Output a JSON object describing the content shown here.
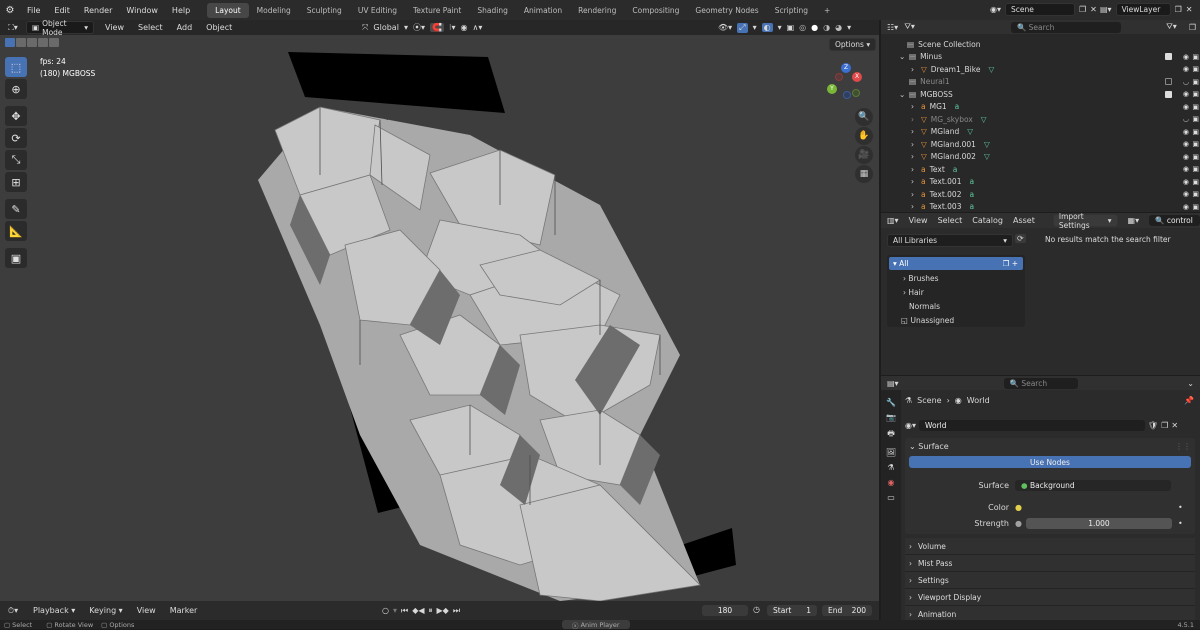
{
  "topbar": {
    "menus": [
      "File",
      "Edit",
      "Render",
      "Window",
      "Help"
    ],
    "workspaces": [
      "Layout",
      "Modeling",
      "Sculpting",
      "UV Editing",
      "Texture Paint",
      "Shading",
      "Animation",
      "Rendering",
      "Compositing",
      "Geometry Nodes",
      "Scripting"
    ],
    "active_workspace": "Layout",
    "add_tab": "+",
    "scene": "Scene",
    "view_layer": "ViewLayer"
  },
  "viewport_header": {
    "mode": "Object Mode",
    "menus": [
      "View",
      "Select",
      "Add",
      "Object"
    ],
    "transform": "Global",
    "options": "Options"
  },
  "viewport": {
    "fps": "fps: 24",
    "frame_label": "(180) MGBOSS",
    "axis": {
      "x": "X",
      "y": "Y",
      "z": "Z"
    }
  },
  "outliner": {
    "search_placeholder": "Search",
    "root": "Scene Collection",
    "rows": [
      {
        "name": "Minus",
        "type": "collection",
        "indent": 1
      },
      {
        "name": "Dream1_Bike",
        "type": "mesh",
        "indent": 2
      },
      {
        "name": "Neural1",
        "type": "collection",
        "indent": 1,
        "dim": true
      },
      {
        "name": "MGBOSS",
        "type": "collection",
        "indent": 1
      },
      {
        "name": "MG1",
        "type": "text",
        "indent": 2
      },
      {
        "name": "MG_skybox",
        "type": "mesh",
        "indent": 2,
        "dim": true
      },
      {
        "name": "MGland",
        "type": "mesh",
        "indent": 2
      },
      {
        "name": "MGland.001",
        "type": "mesh",
        "indent": 2
      },
      {
        "name": "MGland.002",
        "type": "mesh",
        "indent": 2
      },
      {
        "name": "Text",
        "type": "text",
        "indent": 2
      },
      {
        "name": "Text.001",
        "type": "text",
        "indent": 2
      },
      {
        "name": "Text.002",
        "type": "text",
        "indent": 2
      },
      {
        "name": "Text.003",
        "type": "text",
        "indent": 2
      }
    ]
  },
  "asset_browser": {
    "menus": [
      "View",
      "Select",
      "Catalog",
      "Asset"
    ],
    "import_settings": "Import Settings",
    "search_value": "control",
    "library": "All Libraries",
    "catalogs": [
      {
        "label": "All",
        "selected": true
      },
      {
        "label": "Brushes"
      },
      {
        "label": "Hair"
      },
      {
        "label": "Normals"
      },
      {
        "label": "Unassigned"
      }
    ],
    "empty_message": "No results match the search filter"
  },
  "properties": {
    "search_placeholder": "Search",
    "breadcrumb_scene": "Scene",
    "breadcrumb_world": "World",
    "datablock": "World",
    "surface_panel": "Surface",
    "use_nodes": "Use Nodes",
    "surface_label": "Surface",
    "surface_value": "Background",
    "color_label": "Color",
    "strength_label": "Strength",
    "strength_value": "1.000",
    "collapsed_panels": [
      "Volume",
      "Mist Pass",
      "Settings",
      "Viewport Display",
      "Animation"
    ]
  },
  "timeline": {
    "menus": [
      "Playback",
      "Keying",
      "View",
      "Marker"
    ],
    "current_frame": "180",
    "start_label": "Start",
    "start_value": "1",
    "end_label": "End",
    "end_value": "200"
  },
  "statusbar": {
    "select": "Select",
    "rotate": "Rotate View",
    "options": "Options",
    "anim_player": "Anim Player",
    "version": "4.5.1"
  },
  "colors": {
    "accent": "#4772b3",
    "background": "#3d3d3d",
    "panel": "#303030"
  }
}
